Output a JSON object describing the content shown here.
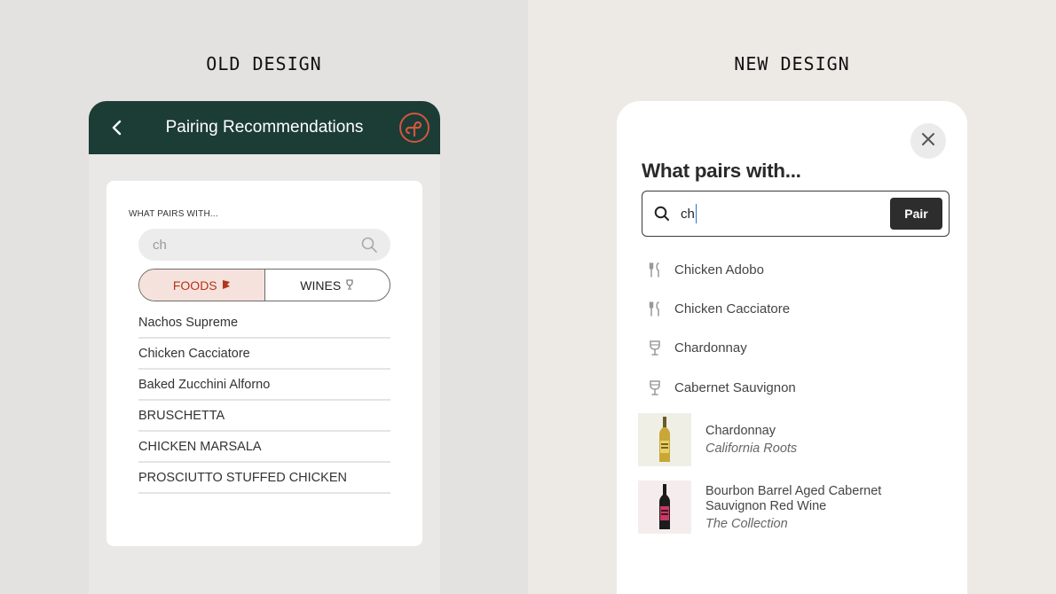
{
  "old_design": {
    "heading": "OLD DESIGN",
    "header": {
      "title": "Pairing Recommendations"
    },
    "card": {
      "label": "WHAT PAIRS WITH...",
      "search": {
        "value": "ch"
      },
      "toggle": {
        "foods_label": "FOODS",
        "wines_label": "WINES",
        "active": "foods"
      },
      "results": [
        "Nachos Supreme",
        "Chicken Cacciatore",
        "Baked Zucchini Alforno",
        "BRUSCHETTA",
        "CHICKEN MARSALA",
        "PROSCIUTTO STUFFED CHICKEN"
      ]
    },
    "colors": {
      "header_bg": "#1b3d36",
      "accent": "#b3351c",
      "active_bg": "#f6e2dc"
    }
  },
  "new_design": {
    "heading": "NEW DESIGN",
    "title": "What pairs with...",
    "search": {
      "value": "ch",
      "button_label": "Pair"
    },
    "suggestions": [
      {
        "label": "Chicken Adobo",
        "icon": "fork-knife-icon"
      },
      {
        "label": "Chicken Cacciatore",
        "icon": "fork-knife-icon"
      },
      {
        "label": "Chardonnay",
        "icon": "wine-glass-icon"
      },
      {
        "label": "Cabernet Sauvignon",
        "icon": "wine-glass-icon"
      }
    ],
    "products": [
      {
        "name": "Chardonnay",
        "subtitle": "California Roots",
        "bottle": "white-wine-bottle"
      },
      {
        "name": "Bourbon Barrel Aged Cabernet Sauvignon Red Wine",
        "subtitle": "The Collection",
        "bottle": "red-wine-bottle"
      }
    ],
    "colors": {
      "button_bg": "#2d2d2d",
      "caret": "#2f6fd6"
    }
  }
}
